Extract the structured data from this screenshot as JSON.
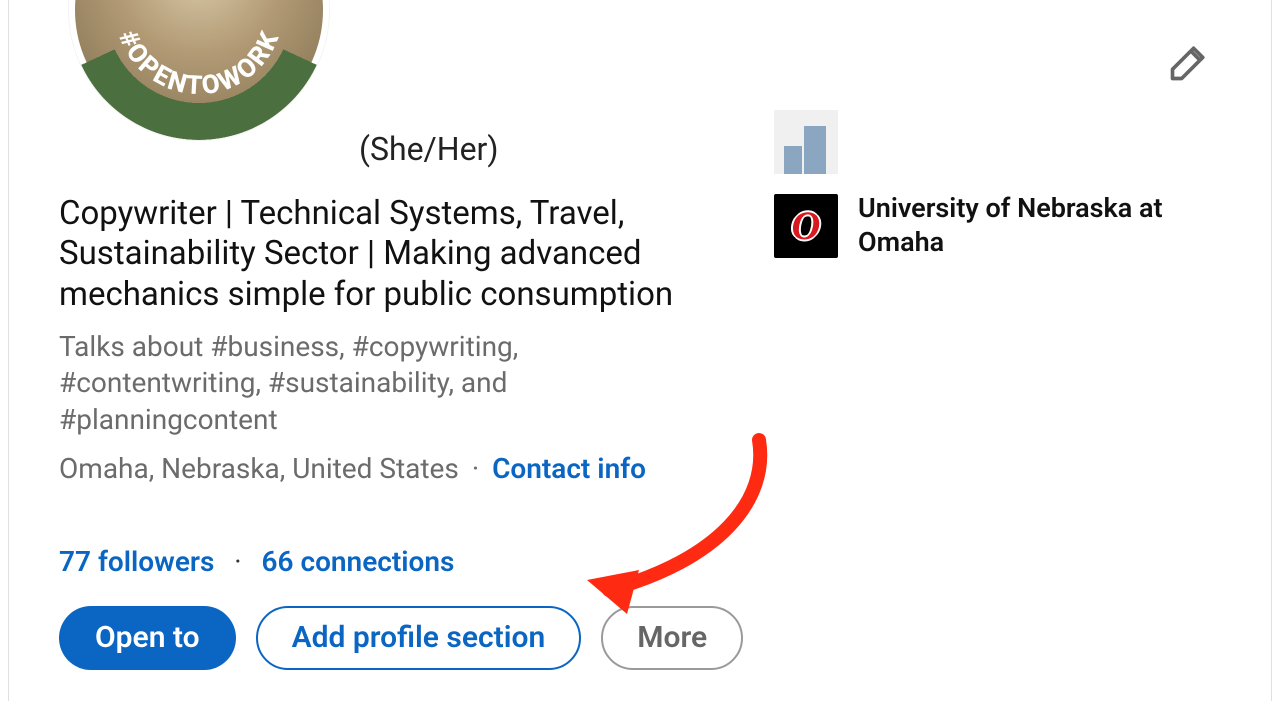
{
  "profile": {
    "open_to_work_band": "#OPENTOWORK",
    "pronouns": "(She/Her)",
    "headline": "Copywriter | Technical Systems, Travel, Sustainability Sector | Making advanced mechanics simple for public consumption",
    "talks_about": "Talks about #business, #copywriting, #contentwriting, #sustainability, and #planningcontent",
    "location": "Omaha, Nebraska, United States",
    "contact_info_label": "Contact info",
    "followers_text": "77 followers",
    "connections_text": "66 connections"
  },
  "buttons": {
    "open_to": "Open to",
    "add_section": "Add profile section",
    "more": "More"
  },
  "education": {
    "company_name": "",
    "school_name": "University of Nebraska at Omaha"
  },
  "icons": {
    "edit": "pencil-icon"
  },
  "colors": {
    "link_blue": "#0a66c2",
    "annotation_red": "#ff2a12",
    "band_green": "#4b6f3e"
  }
}
